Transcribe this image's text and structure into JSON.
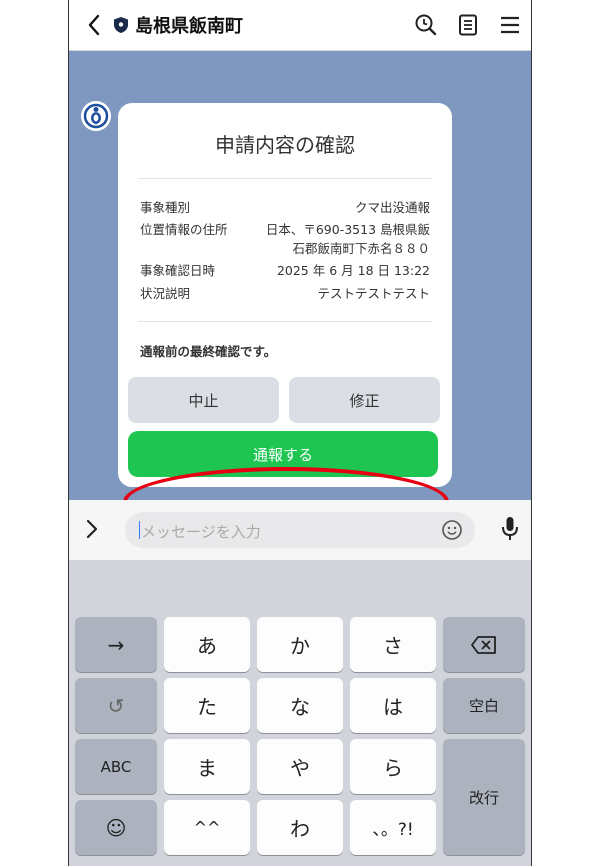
{
  "header": {
    "title": "島根県飯南町",
    "icons": [
      "chevron-left-icon",
      "shield-icon",
      "search-clock-icon",
      "notes-icon",
      "menu-icon"
    ]
  },
  "card": {
    "title": "申請内容の確認",
    "details": [
      {
        "label": "事象種別",
        "value": "クマ出没通報"
      },
      {
        "label": "位置情報の住所",
        "value": "日本、〒690-3513 島根県飯",
        "value2": "石郡飯南町下赤名８８０"
      },
      {
        "label": "事象確認日時",
        "value": "2025 年 6 月 18 日 13:22"
      },
      {
        "label": "状況説明",
        "value": "テストテストテスト"
      }
    ],
    "note": "通報前の最終確認です。",
    "cancel_label": "中止",
    "edit_label": "修正",
    "submit_label": "通報する",
    "colors": {
      "submit": "#1ec651",
      "highlight": "#e60012"
    }
  },
  "input": {
    "placeholder": "メッセージを入力"
  },
  "keyboard": {
    "row1": [
      "→",
      "あ",
      "か",
      "さ",
      "⌫"
    ],
    "row2": [
      "↺",
      "た",
      "な",
      "は",
      "空白"
    ],
    "row3": [
      "ABC",
      "ま",
      "や",
      "ら",
      "改行"
    ],
    "row4": [
      "☺",
      "^^",
      "わ",
      "、。?!"
    ]
  }
}
